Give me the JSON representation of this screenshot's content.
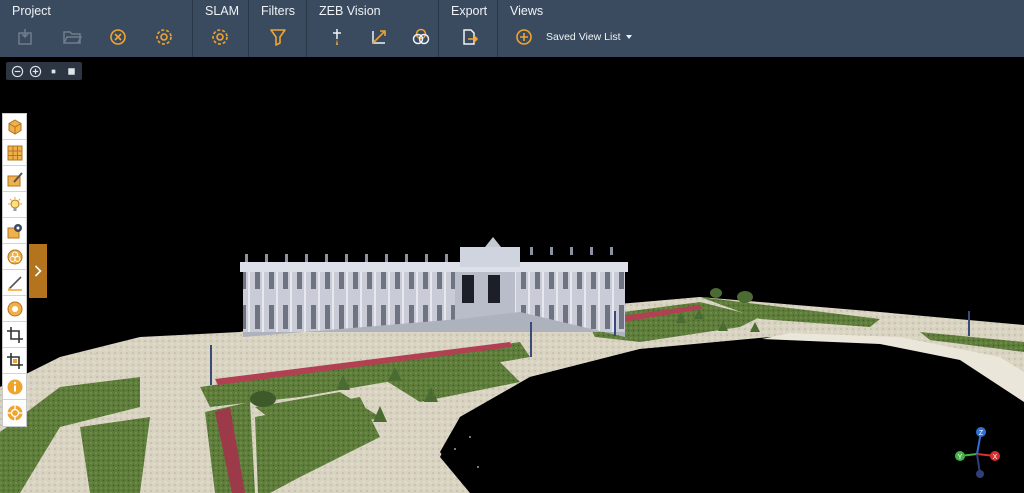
{
  "ribbon": {
    "groups": [
      {
        "label": "Project",
        "buttons": [
          "import-icon",
          "open-folder-icon",
          "close-circle-icon",
          "settings-gear-icon"
        ]
      },
      {
        "label": "SLAM",
        "buttons": [
          "slam-settings-icon"
        ]
      },
      {
        "label": "Filters",
        "buttons": [
          "filter-funnel-icon"
        ]
      },
      {
        "label": "ZEB Vision",
        "buttons": [
          "pin-icon",
          "axes-icon",
          "colorize-icon"
        ]
      },
      {
        "label": "Export",
        "buttons": [
          "export-file-icon"
        ]
      },
      {
        "label": "Views",
        "buttons": [
          "add-view-icon"
        ]
      }
    ],
    "saved_view_list": "Saved View List"
  },
  "zoom_bar": {
    "buttons": [
      "zoom-out-icon",
      "zoom-in-icon",
      "small-square-icon",
      "large-square-icon"
    ]
  },
  "sidebar": {
    "tools": [
      "cube-view-icon",
      "grid-view-icon",
      "paint-brush-icon",
      "lightbulb-icon",
      "camera-icon",
      "layers-circles-icon",
      "measure-pen-icon",
      "point-size-icon",
      "crop-icon",
      "crop-inverse-icon",
      "info-icon",
      "target-icon"
    ]
  },
  "colors": {
    "ribbon_bg": "#3b4b5f",
    "accent_orange": "#f0a430",
    "expand_tab": "#b3741d",
    "axis_z": "#2f6fd8",
    "axis_x": "#d83030",
    "axis_y": "#46b04a"
  },
  "axis_gizmo": {
    "z": "Z",
    "x": "X",
    "y": "Y"
  }
}
